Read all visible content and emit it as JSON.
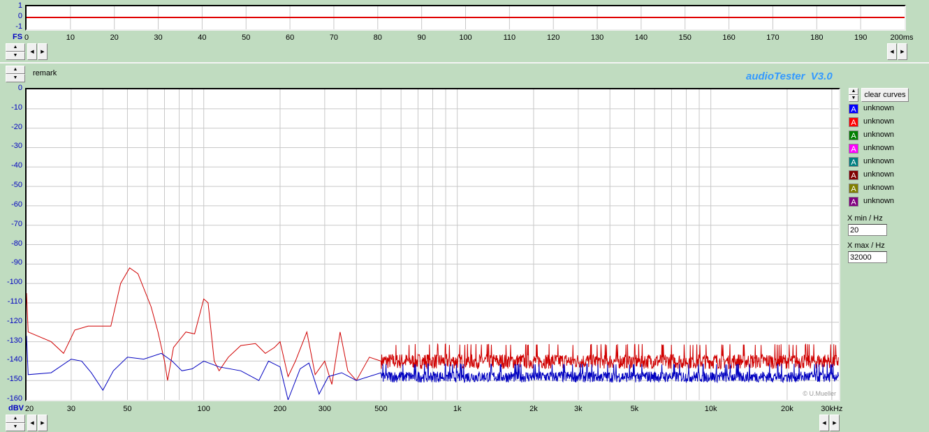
{
  "top_plot": {
    "y_ticks": [
      "1",
      "0",
      "-1"
    ],
    "x_ticks": [
      "0",
      "10",
      "20",
      "30",
      "40",
      "50",
      "60",
      "70",
      "80",
      "90",
      "100",
      "110",
      "120",
      "130",
      "140",
      "150",
      "160",
      "170",
      "180",
      "190",
      "200ms"
    ],
    "unit_label": "FS",
    "line_color": "#e00000"
  },
  "remark": "remark",
  "app_title": "audioTester  V3.0",
  "copyright": "© U.Mueller",
  "main_plot": {
    "unit_label": "dBV",
    "x_ticks": [
      {
        "f": 20,
        "l": "20"
      },
      {
        "f": 30,
        "l": "30"
      },
      {
        "f": 50,
        "l": "50"
      },
      {
        "f": 100,
        "l": "100"
      },
      {
        "f": 200,
        "l": "200"
      },
      {
        "f": 300,
        "l": "300"
      },
      {
        "f": 500,
        "l": "500"
      },
      {
        "f": 1000,
        "l": "1k"
      },
      {
        "f": 2000,
        "l": "2k"
      },
      {
        "f": 3000,
        "l": "3k"
      },
      {
        "f": 5000,
        "l": "5k"
      },
      {
        "f": 10000,
        "l": "10k"
      },
      {
        "f": 20000,
        "l": "20k"
      },
      {
        "f": 30000,
        "l": "30kHz"
      }
    ]
  },
  "clear_curves": "clear curves",
  "curves": [
    {
      "label": "unknown",
      "color": "#0000ff"
    },
    {
      "label": "unknown",
      "color": "#ff0000"
    },
    {
      "label": "unknown",
      "color": "#008000"
    },
    {
      "label": "unknown",
      "color": "#ff00ff"
    },
    {
      "label": "unknown",
      "color": "#008080"
    },
    {
      "label": "unknown",
      "color": "#800000"
    },
    {
      "label": "unknown",
      "color": "#808000"
    },
    {
      "label": "unknown",
      "color": "#800080"
    }
  ],
  "curve_glyph": "A",
  "xmin_label": "X min / Hz",
  "xmin": "20",
  "xmax_label": "X max / Hz",
  "xmax": "32000",
  "chart_data": {
    "type": "line",
    "xlabel": "Hz",
    "ylabel": "dBV",
    "xscale": "log",
    "xlim": [
      20,
      32000
    ],
    "ylim": [
      -160,
      0
    ],
    "grid": true,
    "series": [
      {
        "name": "red",
        "color": "#d00000",
        "points": [
          [
            20,
            -105
          ],
          [
            20.3,
            -125
          ],
          [
            25,
            -130
          ],
          [
            28,
            -136
          ],
          [
            31,
            -124
          ],
          [
            35,
            -122
          ],
          [
            43,
            -122
          ],
          [
            47,
            -100
          ],
          [
            51,
            -92
          ],
          [
            55,
            -95
          ],
          [
            62,
            -112
          ],
          [
            66,
            -125
          ],
          [
            70,
            -140
          ],
          [
            72,
            -150
          ],
          [
            76,
            -133
          ],
          [
            85,
            -125
          ],
          [
            92,
            -126
          ],
          [
            100,
            -108
          ],
          [
            104,
            -110
          ],
          [
            110,
            -140
          ],
          [
            115,
            -145
          ],
          [
            125,
            -138
          ],
          [
            140,
            -132
          ],
          [
            160,
            -131
          ],
          [
            175,
            -136
          ],
          [
            190,
            -133
          ],
          [
            200,
            -130
          ],
          [
            215,
            -148
          ],
          [
            230,
            -140
          ],
          [
            255,
            -125
          ],
          [
            275,
            -147
          ],
          [
            300,
            -140
          ],
          [
            320,
            -152
          ],
          [
            345,
            -125
          ],
          [
            370,
            -145
          ],
          [
            400,
            -150
          ],
          [
            450,
            -138
          ],
          [
            500,
            -140
          ]
        ],
        "noise_base": -140,
        "noise_amp": 8
      },
      {
        "name": "blue",
        "color": "#0000c0",
        "points": [
          [
            20,
            -127
          ],
          [
            20.3,
            -147
          ],
          [
            25,
            -146
          ],
          [
            30,
            -139
          ],
          [
            33,
            -140
          ],
          [
            36,
            -146
          ],
          [
            40,
            -155
          ],
          [
            44,
            -145
          ],
          [
            50,
            -138
          ],
          [
            58,
            -139
          ],
          [
            68,
            -136
          ],
          [
            75,
            -140
          ],
          [
            82,
            -145
          ],
          [
            90,
            -144
          ],
          [
            100,
            -140
          ],
          [
            115,
            -143
          ],
          [
            140,
            -145
          ],
          [
            165,
            -150
          ],
          [
            180,
            -140
          ],
          [
            200,
            -143
          ],
          [
            215,
            -160
          ],
          [
            240,
            -144
          ],
          [
            260,
            -141
          ],
          [
            285,
            -157
          ],
          [
            310,
            -148
          ],
          [
            350,
            -146
          ],
          [
            400,
            -150
          ],
          [
            500,
            -146
          ]
        ],
        "noise_base": -148,
        "noise_amp": 6
      }
    ]
  }
}
